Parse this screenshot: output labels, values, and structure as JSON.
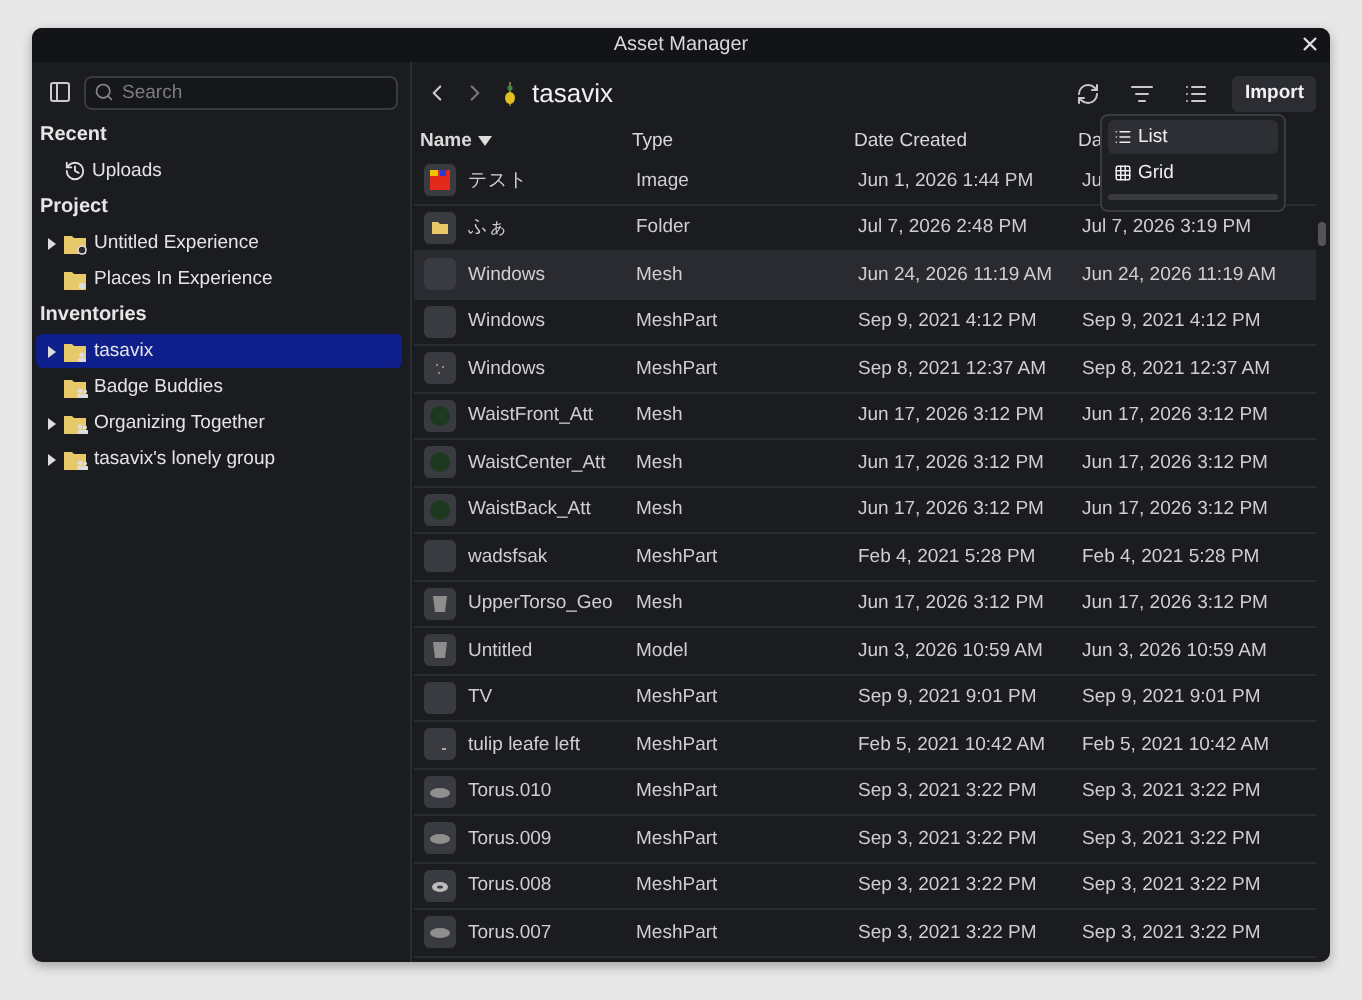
{
  "window": {
    "title": "Asset Manager"
  },
  "sidebar": {
    "search": {
      "placeholder": "Search"
    },
    "sections": [
      {
        "title": "Recent",
        "items": [
          {
            "label": "Uploads",
            "kind": "history",
            "selected": false
          }
        ]
      },
      {
        "title": "Project",
        "items": [
          {
            "label": "Untitled Experience",
            "kind": "gear",
            "expandable": true,
            "selected": false
          },
          {
            "label": "Places In Experience",
            "kind": "pin",
            "expandable": false,
            "selected": false
          }
        ]
      },
      {
        "title": "Inventories",
        "items": [
          {
            "label": "tasavix",
            "kind": "user",
            "expandable": true,
            "selected": true
          },
          {
            "label": "Badge Buddies",
            "kind": "group",
            "expandable": false,
            "selected": false
          },
          {
            "label": "Organizing Together",
            "kind": "group",
            "expandable": true,
            "selected": false
          },
          {
            "label": "tasavix's lonely group",
            "kind": "group",
            "expandable": true,
            "selected": false
          }
        ]
      }
    ]
  },
  "toolbar": {
    "path": "tasavix",
    "import_button": "Import"
  },
  "view_menu": {
    "items": [
      {
        "label": "List",
        "kind": "list",
        "selected": true
      },
      {
        "label": "Grid",
        "kind": "grid",
        "selected": false
      }
    ]
  },
  "table": {
    "columns": [
      {
        "label": "Name",
        "sorted": true
      },
      {
        "label": "Type",
        "sorted": false
      },
      {
        "label": "Date Created",
        "sorted": false
      },
      {
        "label": "Da",
        "sorted": false
      }
    ],
    "rows": [
      {
        "kind": "image",
        "name": "テスト",
        "type": "Image",
        "created": "Jun 1, 2026 1:44 PM",
        "column_4": "Ju",
        "highlighted": false
      },
      {
        "kind": "folder",
        "name": "ふぁ",
        "type": "Folder",
        "created": "Jul 7, 2026 2:48 PM",
        "column_4": "Jul 7, 2026 3:19 PM",
        "highlighted": false
      },
      {
        "kind": "blank",
        "name": "Windows",
        "type": "Mesh",
        "created": "Jun 24, 2026 11:19 AM",
        "column_4": "Jun 24, 2026 11:19 AM",
        "highlighted": true
      },
      {
        "kind": "blank",
        "name": "Windows",
        "type": "MeshPart",
        "created": "Sep 9, 2021 4:12 PM",
        "column_4": "Sep 9, 2021 4:12 PM",
        "highlighted": false
      },
      {
        "kind": "dots",
        "name": "Windows",
        "type": "MeshPart",
        "created": "Sep 8, 2021 12:37 AM",
        "column_4": "Sep 8, 2021 12:37 AM",
        "highlighted": false
      },
      {
        "kind": "sphere",
        "name": "WaistFront_Att",
        "type": "Mesh",
        "created": "Jun 17, 2026 3:12 PM",
        "column_4": "Jun 17, 2026 3:12 PM",
        "highlighted": false
      },
      {
        "kind": "sphere",
        "name": "WaistCenter_Att",
        "type": "Mesh",
        "created": "Jun 17, 2026 3:12 PM",
        "column_4": "Jun 17, 2026 3:12 PM",
        "highlighted": false
      },
      {
        "kind": "sphere",
        "name": "WaistBack_Att",
        "type": "Mesh",
        "created": "Jun 17, 2026 3:12 PM",
        "column_4": "Jun 17, 2026 3:12 PM",
        "highlighted": false
      },
      {
        "kind": "blank",
        "name": "wadsfsak",
        "type": "MeshPart",
        "created": "Feb 4, 2021 5:28 PM",
        "column_4": "Feb 4, 2021 5:28 PM",
        "highlighted": false
      },
      {
        "kind": "torso",
        "name": "UpperTorso_Geo",
        "type": "Mesh",
        "created": "Jun 17, 2026 3:12 PM",
        "column_4": "Jun 17, 2026 3:12 PM",
        "highlighted": false
      },
      {
        "kind": "torso",
        "name": "Untitled",
        "type": "Model",
        "created": "Jun 3, 2026 10:59 AM",
        "column_4": "Jun 3, 2026 10:59 AM",
        "highlighted": false
      },
      {
        "kind": "blank",
        "name": "TV",
        "type": "MeshPart",
        "created": "Sep 9, 2021 9:01 PM",
        "column_4": "Sep 9, 2021 9:01 PM",
        "highlighted": false
      },
      {
        "kind": "leaf",
        "name": "tulip leafe left",
        "type": "MeshPart",
        "created": "Feb 5, 2021 10:42 AM",
        "column_4": "Feb 5, 2021 10:42 AM",
        "highlighted": false
      },
      {
        "kind": "torus",
        "name": "Torus.010",
        "type": "MeshPart",
        "created": "Sep 3, 2021 3:22 PM",
        "column_4": "Sep 3, 2021 3:22 PM",
        "highlighted": false
      },
      {
        "kind": "torus",
        "name": "Torus.009",
        "type": "MeshPart",
        "created": "Sep 3, 2021 3:22 PM",
        "column_4": "Sep 3, 2021 3:22 PM",
        "highlighted": false
      },
      {
        "kind": "ring",
        "name": "Torus.008",
        "type": "MeshPart",
        "created": "Sep 3, 2021 3:22 PM",
        "column_4": "Sep 3, 2021 3:22 PM",
        "highlighted": false
      },
      {
        "kind": "torus",
        "name": "Torus.007",
        "type": "MeshPart",
        "created": "Sep 3, 2021 3:22 PM",
        "column_4": "Sep 3, 2021 3:22 PM",
        "highlighted": false
      }
    ]
  }
}
